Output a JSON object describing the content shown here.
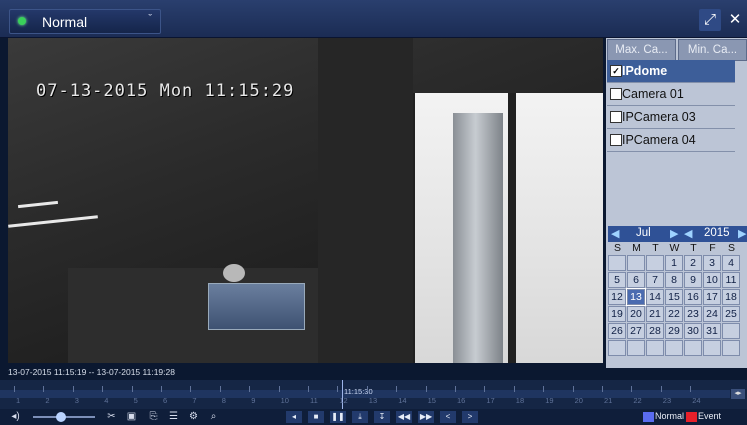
{
  "topbar": {
    "mode_label": "Normal",
    "mode_chevron_glyph": "ˇ",
    "fullscreen_glyph": "⤢",
    "close_glyph": "✕"
  },
  "video": {
    "osd_timestamp": "07-13-2015 Mon 11:15:29"
  },
  "panel": {
    "max_button": "Max. Ca...",
    "min_button": "Min. Ca...",
    "cameras": [
      {
        "name": "IPdome",
        "checked": true
      },
      {
        "name": "Camera 01",
        "checked": false
      },
      {
        "name": "IPCamera 03",
        "checked": false
      },
      {
        "name": "IPCamera 04",
        "checked": false
      }
    ],
    "check_glyph": "✓"
  },
  "calendar": {
    "month": "Jul",
    "year": "2015",
    "prev_glyph": "◀",
    "next_glyph": "▶",
    "weekdays": [
      "S",
      "M",
      "T",
      "W",
      "T",
      "F",
      "S"
    ],
    "weeks": [
      [
        "",
        "",
        "",
        "1",
        "2",
        "3",
        "4"
      ],
      [
        "5",
        "6",
        "7",
        "8",
        "9",
        "10",
        "11"
      ],
      [
        "12",
        "13",
        "14",
        "15",
        "16",
        "17",
        "18"
      ],
      [
        "19",
        "20",
        "21",
        "22",
        "23",
        "24",
        "25"
      ],
      [
        "26",
        "27",
        "28",
        "29",
        "30",
        "31",
        ""
      ],
      [
        "",
        "",
        "",
        "",
        "",
        "",
        ""
      ]
    ],
    "selected_day": "13"
  },
  "timeline": {
    "range_label": "13-07-2015 11:15:19 -- 13-07-2015 11:19:28",
    "cursor_time": "11:15:30",
    "hours": [
      "1",
      "2",
      "3",
      "4",
      "5",
      "6",
      "7",
      "8",
      "9",
      "10",
      "11",
      "12",
      "13",
      "14",
      "15",
      "16",
      "17",
      "18",
      "19",
      "20",
      "21",
      "22",
      "23",
      "24"
    ],
    "end_button_glyph": "◂▸"
  },
  "controls": {
    "volume_glyph": "◂)",
    "volume_level": 0.45,
    "left_tools": [
      "✂",
      "▣",
      "⎘",
      "☰",
      "⚙",
      "⌕"
    ],
    "playback": [
      "◂",
      "■",
      "❚❚",
      "⤓",
      "↧",
      "◀◀",
      "▶▶",
      "<",
      ">"
    ],
    "legend": [
      {
        "label": "Normal",
        "color": "#5a6cf0"
      },
      {
        "label": "Event",
        "color": "#e8202a"
      }
    ]
  },
  "colors": {
    "accent": "#2f5196",
    "selected_row": "#3d5e99",
    "topbar": "#1b2c54"
  }
}
